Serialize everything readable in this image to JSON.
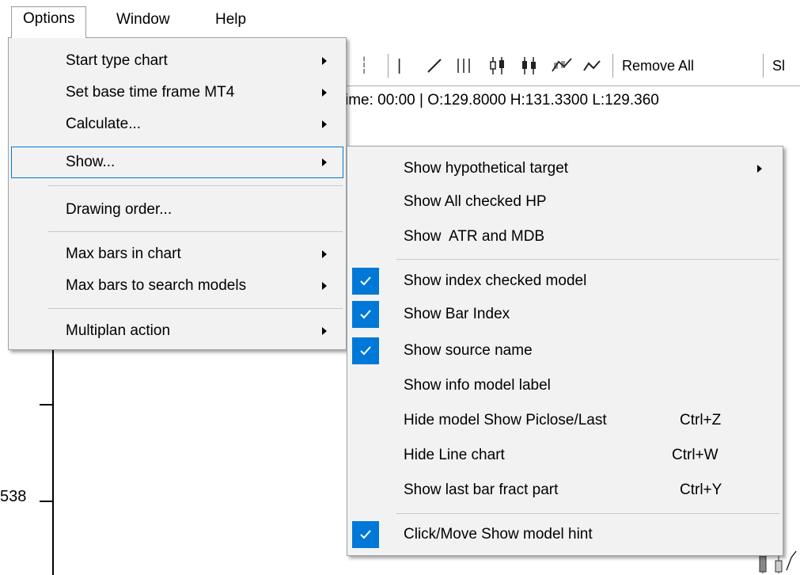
{
  "menubar": {
    "items": [
      {
        "label": "Options",
        "open": true
      },
      {
        "label": "Window"
      },
      {
        "label": "Help"
      }
    ]
  },
  "toolbar": {
    "remove_all_label": "Remove All",
    "cut_label": "Sl"
  },
  "status": {
    "text": "ime:  00:00  |  O:129.8000  H:131.3300  L:129.360"
  },
  "chart": {
    "ylabel": "538"
  },
  "options_menu": {
    "items": [
      {
        "label": "Start type chart",
        "submenu": true
      },
      {
        "label": "Set base time frame MT4",
        "submenu": true
      },
      {
        "label": "Calculate...",
        "submenu": true
      },
      {
        "label": "Show...",
        "submenu": true,
        "highlighted": true
      },
      {
        "label": "Drawing order..."
      },
      {
        "label": "Max bars in chart",
        "submenu": true
      },
      {
        "label": "Max bars to search models",
        "submenu": true
      },
      {
        "label": "Multiplan action",
        "submenu": true
      }
    ]
  },
  "show_menu": {
    "items": [
      {
        "label": "Show hypothetical target",
        "submenu": true
      },
      {
        "label": "Show All checked HP"
      },
      {
        "label": "Show  ATR and MDB"
      },
      {
        "label": "Show index checked model",
        "checked": true
      },
      {
        "label": "Show Bar Index",
        "checked": true
      },
      {
        "label": "Show source name",
        "checked": true
      },
      {
        "label": "Show info model label"
      },
      {
        "label": "Hide model Show Piclose/Last",
        "shortcut": "Ctrl+Z"
      },
      {
        "label": "Hide Line chart",
        "shortcut": "Ctrl+W"
      },
      {
        "label": "Show last bar fract part",
        "shortcut": "Ctrl+Y"
      },
      {
        "label": "Click/Move Show model hint",
        "checked": true
      }
    ]
  },
  "colors": {
    "accent": "#0078d7",
    "menu_bg": "#f2f2f2"
  }
}
